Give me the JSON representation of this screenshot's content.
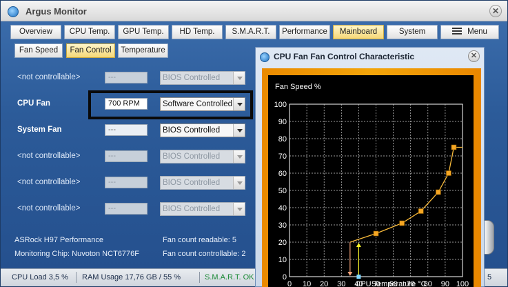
{
  "window": {
    "title": "Argus Monitor",
    "close_glyph": "✕"
  },
  "main_tabs": [
    {
      "label": "Overview"
    },
    {
      "label": "CPU Temp."
    },
    {
      "label": "GPU Temp."
    },
    {
      "label": "HD Temp."
    },
    {
      "label": "S.M.A.R.T."
    },
    {
      "label": "Performance"
    },
    {
      "label": "Mainboard",
      "active": true
    },
    {
      "label": "System"
    },
    {
      "label": "Menu"
    }
  ],
  "sub_tabs": [
    {
      "label": "Fan Speed"
    },
    {
      "label": "Fan Control",
      "active": true
    },
    {
      "label": "Temperature"
    }
  ],
  "fans": [
    {
      "name": "<not controllable>",
      "rpm": "---",
      "mode": "BIOS Controlled",
      "enabled": false
    },
    {
      "name": "CPU Fan",
      "rpm": "700 RPM",
      "mode": "Software Controlled",
      "enabled": true
    },
    {
      "name": "System Fan",
      "rpm": "---",
      "mode": "BIOS Controlled",
      "enabled": true
    },
    {
      "name": "<not controllable>",
      "rpm": "---",
      "mode": "BIOS Controlled",
      "enabled": false
    },
    {
      "name": "<not controllable>",
      "rpm": "---",
      "mode": "BIOS Controlled",
      "enabled": false
    },
    {
      "name": "<not controllable>",
      "rpm": "---",
      "mode": "BIOS Controlled",
      "enabled": false
    }
  ],
  "info": {
    "board": "ASRock H97 Performance",
    "chip": "Monitoring Chip: Nuvoton NCT6776F",
    "fan_readable": "Fan count readable: 5",
    "fan_controllable": "Fan count controllable: 2"
  },
  "status": {
    "cpu_load": "CPU Load 3,5 %",
    "ram_usage": "RAM Usage 17,76 GB / 55 %",
    "smart": "S.M.A.R.T. OK",
    "right_fragment": "5"
  },
  "popup": {
    "title": "CPU Fan Fan Control Characteristic",
    "close_glyph": "✕"
  },
  "colors": {
    "accent_orange": "#f39a0a",
    "curve_line": "#f7b93a",
    "control_point": "#f5a623",
    "indicator_yellow": "#f7f32a",
    "indicator_salmon": "#f4a27a",
    "indicator_cyan": "#7fd6ff",
    "grid_line": "#cfcfcf"
  },
  "chart_data": {
    "type": "line",
    "ylabel": "Fan Speed %",
    "xlabel": "CPU Temperature °C",
    "xlim": [
      0,
      100
    ],
    "ylim": [
      0,
      100
    ],
    "x_ticks": [
      0,
      10,
      20,
      30,
      40,
      50,
      60,
      70,
      80,
      90,
      100
    ],
    "y_ticks": [
      0,
      10,
      20,
      30,
      40,
      50,
      60,
      70,
      80,
      90,
      100
    ],
    "grid": true,
    "series": [
      {
        "x": [
          35,
          50,
          65,
          76,
          86,
          92,
          95,
          100
        ],
        "y": [
          20,
          25,
          31,
          38,
          49,
          60,
          75,
          75
        ]
      }
    ],
    "markers_x": [
      50,
      65,
      76,
      86,
      92,
      95
    ],
    "current_temperature": 40,
    "current_speed": 20,
    "target_start_temperature": 35
  }
}
